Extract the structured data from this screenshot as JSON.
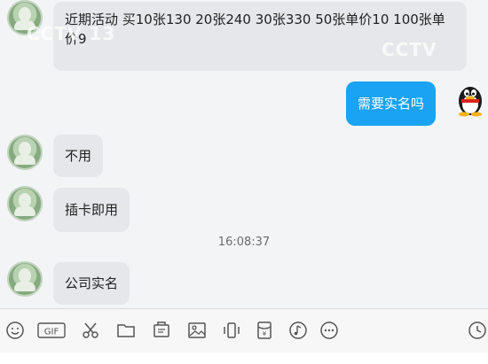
{
  "messages": [
    {
      "side": "in",
      "text": "近期活动 买10张130  20张240  30张330 50张单价10 100张单价9"
    },
    {
      "side": "out",
      "text": "需要实名吗"
    },
    {
      "side": "in",
      "text": "不用"
    },
    {
      "side": "in",
      "text": "插卡即用"
    },
    {
      "side": "in",
      "text": "公司实名"
    }
  ],
  "timestamp": "16:08:37",
  "watermark": {
    "top": "CCTV 13",
    "right": "CCTV"
  },
  "toolbar": {
    "icons": [
      "emoji-icon",
      "gif-icon",
      "scissors-icon",
      "folder-icon",
      "screenshot-icon",
      "image-icon",
      "shake-icon",
      "red-packet-icon",
      "music-icon",
      "more-icon",
      "history-icon"
    ],
    "gif_label": "GIF"
  }
}
